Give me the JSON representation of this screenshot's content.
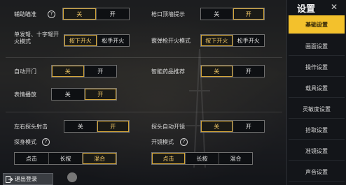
{
  "sidebar": {
    "title": "设置",
    "items": [
      {
        "label": "基础设置",
        "active": true
      },
      {
        "label": "画面设置",
        "active": false
      },
      {
        "label": "操作设置",
        "active": false
      },
      {
        "label": "载具设置",
        "active": false
      },
      {
        "label": "灵敏度设置",
        "active": false
      },
      {
        "label": "拾取设置",
        "active": false
      },
      {
        "label": "准镜设置",
        "active": false
      },
      {
        "label": "声音设置",
        "active": false
      }
    ]
  },
  "settings": {
    "aim_assist": {
      "label": "辅助瞄准",
      "options": [
        "关",
        "开"
      ],
      "selected": "关"
    },
    "muzzle_hint": {
      "label": "枪口顶墙提示",
      "options": [
        "关",
        "开"
      ],
      "selected": "开"
    },
    "fire_mode": {
      "label": "单发弩、十字弩开火模式",
      "options": [
        "按下开火",
        "松手开火"
      ],
      "selected": "按下开火"
    },
    "grenade_fire": {
      "label": "霰弹枪开火模式",
      "options": [
        "按下开火",
        "松手开火"
      ],
      "selected": "按下开火"
    },
    "auto_door": {
      "label": "自动开门",
      "options": [
        "关",
        "开"
      ],
      "selected": "关"
    },
    "smart_medicine": {
      "label": "智能药品推荐",
      "options": [
        "关",
        "开"
      ],
      "selected": "关"
    },
    "emote_play": {
      "label": "表情播放",
      "options": [
        "关",
        "开"
      ],
      "selected": "开"
    },
    "peek_shoot": {
      "label": "左右探头射击",
      "options": [
        "关",
        "开"
      ],
      "selected": "开"
    },
    "peek_auto_scope": {
      "label": "探头自动开镜",
      "options": [
        "关",
        "开"
      ],
      "selected": "关"
    },
    "peek_mode": {
      "label": "探身模式",
      "options": [
        "点击",
        "长按",
        "混合"
      ],
      "selected": "混合"
    },
    "scope_mode": {
      "label": "开镜模式",
      "options": [
        "点击",
        "长按",
        "混合"
      ],
      "selected": "点击"
    }
  },
  "footer": {
    "logout_label": "退出登录"
  },
  "colors": {
    "accent": "#f3c12c",
    "selected_text": "#f2c866",
    "background": "#131519"
  }
}
